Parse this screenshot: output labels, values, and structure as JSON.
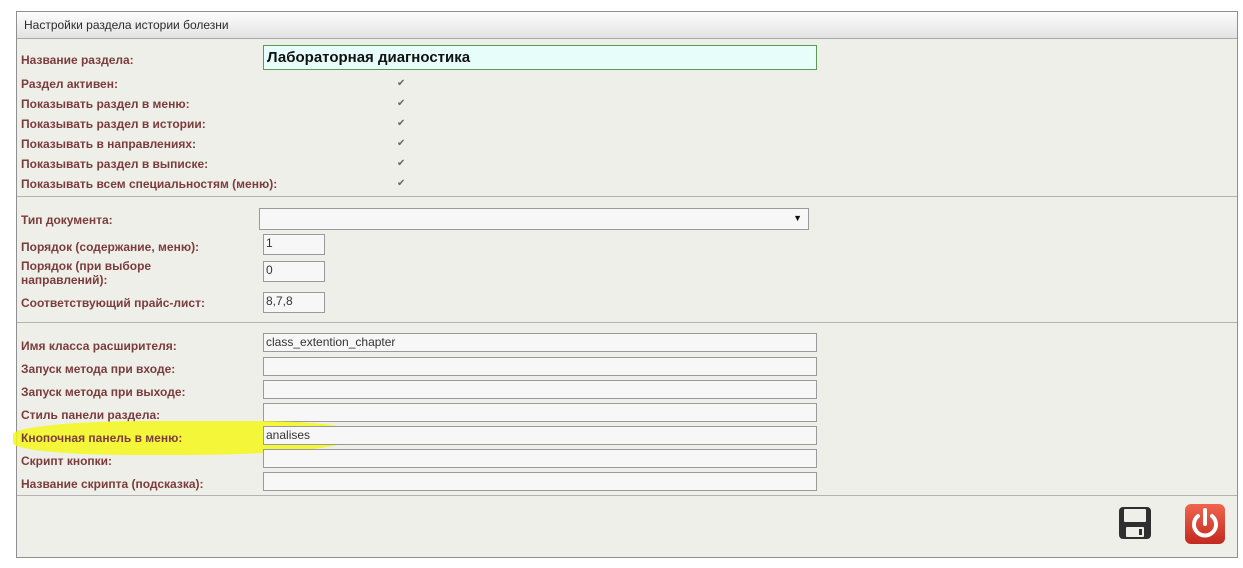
{
  "panel_title": "Настройки раздела истории болезни",
  "section_name": {
    "label": "Название раздела:",
    "value": "Лабораторная диагностика"
  },
  "checkboxes": [
    {
      "label": "Раздел активен:",
      "checked": true
    },
    {
      "label": "Показывать раздел в меню:",
      "checked": true
    },
    {
      "label": "Показывать раздел в истории:",
      "checked": true
    },
    {
      "label": "Показывать в направлениях:",
      "checked": true
    },
    {
      "label": "Показывать раздел в выписке:",
      "checked": true
    },
    {
      "label": "Показывать всем специальностям (меню):",
      "checked": true
    }
  ],
  "check_glyph": "✔",
  "doc_type": {
    "label": "Тип документа:",
    "value": "",
    "arrow": "▼"
  },
  "order_menu": {
    "label": "Порядок (содержание, меню):",
    "value": "1"
  },
  "order_dir": {
    "label": "Порядок (при выборе направлений):",
    "value": "0"
  },
  "price_list": {
    "label": "Соответствующий прайс-лист:",
    "value": "8,7,8"
  },
  "extension_fields": [
    {
      "label": "Имя класса расширителя:",
      "value": "class_extention_chapter"
    },
    {
      "label": "Запуск метода при входе:",
      "value": ""
    },
    {
      "label": "Запуск метода при выходе:",
      "value": ""
    },
    {
      "label": "Стиль панели раздела:",
      "value": ""
    },
    {
      "label": "Кнопочная панель в меню:",
      "value": "analises"
    },
    {
      "label": "Скрипт кнопки:",
      "value": ""
    },
    {
      "label": "Название скрипта (подсказка):",
      "value": ""
    }
  ],
  "icons": {
    "save": "save-icon",
    "power": "power-icon"
  },
  "colors": {
    "label": "#7a3c3c",
    "highlight": "#f4f71a",
    "power_bg": "#d83a2e"
  }
}
